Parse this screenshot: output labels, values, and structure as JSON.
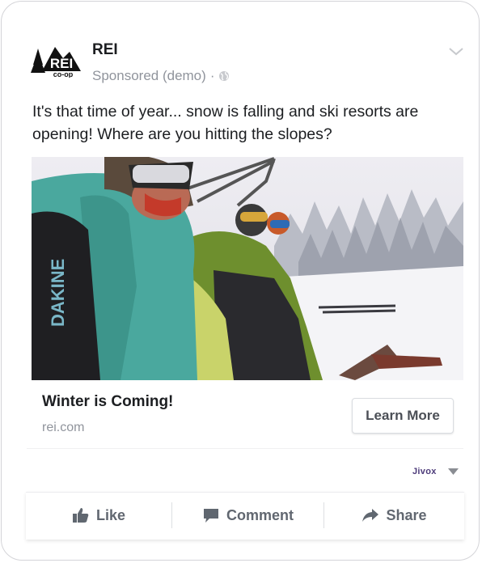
{
  "post": {
    "brand_name": "REI",
    "logo_text_top": "REI",
    "logo_text_bottom": "co-op",
    "sponsored_label": "Sponsored (demo)",
    "separator": "·",
    "body_text": "It's that time of year... snow is falling and ski resorts are opening! Where are you hitting the slopes?"
  },
  "media": {
    "jacket_text": "DAKINE"
  },
  "link": {
    "headline": "Winter is Coming!",
    "domain": "rei.com",
    "cta_label": "Learn More"
  },
  "attribution": {
    "label": "Jivox"
  },
  "actions": {
    "like": "Like",
    "comment": "Comment",
    "share": "Share"
  },
  "colors": {
    "text_primary": "#1c1e21",
    "text_secondary": "#90949c",
    "action_text": "#616770",
    "attribution": "#4c3a79"
  },
  "icons": [
    "rei-logo-icon",
    "globe-icon",
    "chevron-down-icon",
    "caret-down-icon",
    "thumbs-up-icon",
    "comment-icon",
    "share-icon"
  ]
}
